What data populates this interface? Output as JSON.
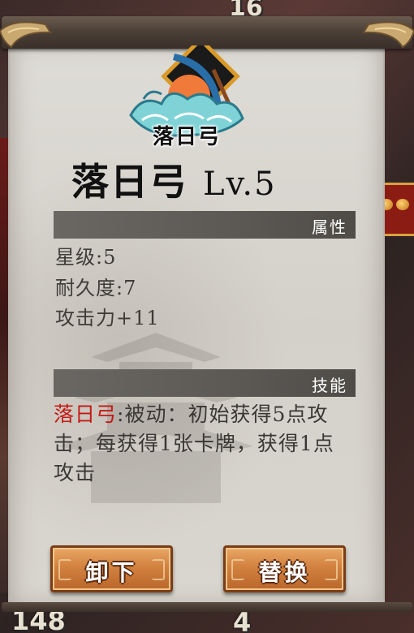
{
  "background": {
    "top_number": "16",
    "bottom_left_number": "148",
    "bottom_mid_number": "4"
  },
  "item": {
    "icon_label": "落日弓",
    "name": "落日弓",
    "level": "Lv.5"
  },
  "sections": {
    "attributes_label": "属性",
    "skills_label": "技能"
  },
  "stats": {
    "star_level": "星级:5",
    "durability": "耐久度:7",
    "attack": "攻击力+11"
  },
  "skill": {
    "name": "落日弓",
    "description": ":被动：初始获得5点攻击；每获得1张卡牌，获得1点攻击"
  },
  "buttons": {
    "unequip": "卸下",
    "replace": "替换"
  },
  "colors": {
    "skill_name": "#c41a16",
    "button": "#d2823f",
    "section_bar": "#5c5955"
  }
}
